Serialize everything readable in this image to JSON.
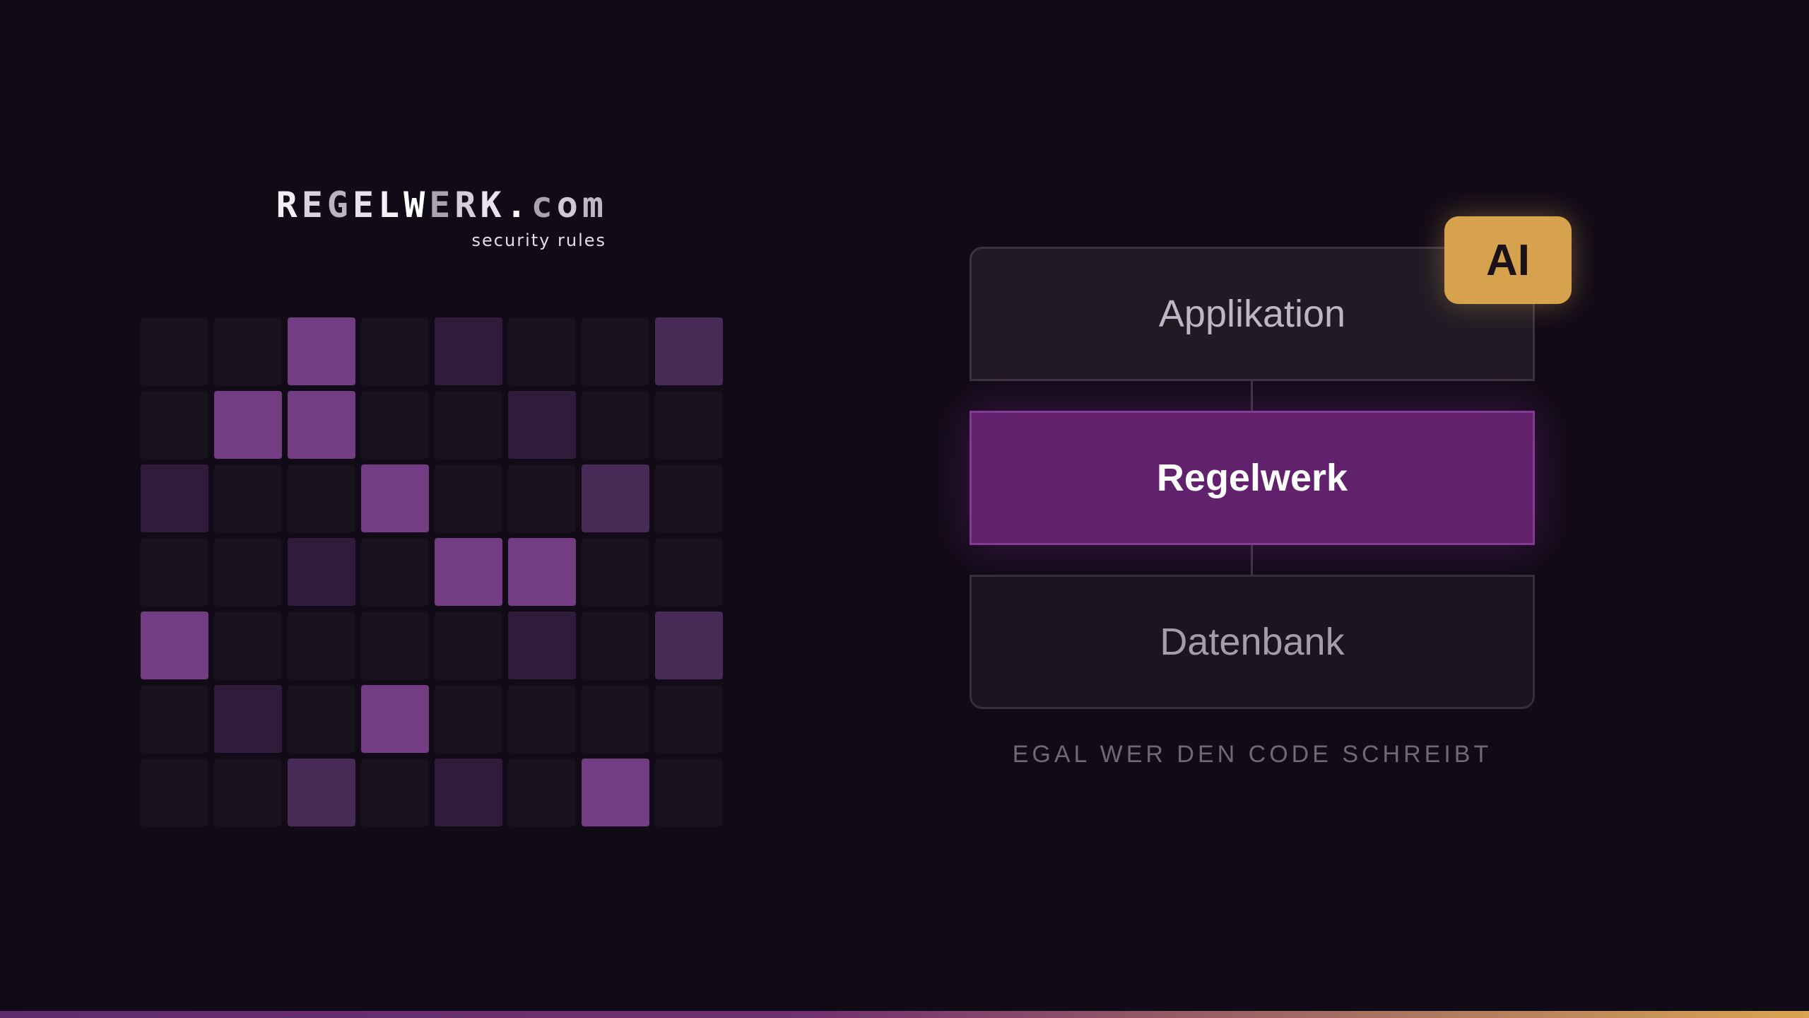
{
  "logo": {
    "letters": [
      {
        "char": "R",
        "color": "#f2eef4"
      },
      {
        "char": "E",
        "color": "#d8d3dc"
      },
      {
        "char": "G",
        "color": "#bab5c0"
      },
      {
        "char": "E",
        "color": "#e6e2ea"
      },
      {
        "char": "L",
        "color": "#f6f3f8"
      },
      {
        "char": "W",
        "color": "#ffffff"
      },
      {
        "char": "E",
        "color": "#a9a4af"
      },
      {
        "char": "R",
        "color": "#d4d0d8"
      },
      {
        "char": "K",
        "color": "#e8e4ec"
      },
      {
        "char": ".",
        "color": "#ffffff"
      },
      {
        "char": "c",
        "color": "#a8a3ad"
      },
      {
        "char": "o",
        "color": "#cfcbd4"
      },
      {
        "char": "m",
        "color": "#bdb8c3"
      }
    ],
    "tagline": "security rules"
  },
  "grid": {
    "rows": [
      [
        0,
        0,
        3,
        0,
        1,
        0,
        0,
        2
      ],
      [
        0,
        3,
        3,
        0,
        0,
        1,
        0,
        0
      ],
      [
        1,
        0,
        0,
        3,
        0,
        0,
        2,
        0
      ],
      [
        0,
        0,
        1,
        0,
        3,
        3,
        0,
        0
      ],
      [
        3,
        0,
        0,
        0,
        0,
        1,
        0,
        2
      ],
      [
        0,
        1,
        0,
        3,
        0,
        0,
        0,
        0
      ],
      [
        0,
        0,
        2,
        0,
        1,
        0,
        3,
        0
      ]
    ]
  },
  "stack": {
    "layers": [
      {
        "label": "Applikation"
      },
      {
        "label": "Regelwerk"
      },
      {
        "label": "Datenbank"
      }
    ],
    "badge": "AI",
    "caption": "EGAL WER DEN CODE SCHREIBT"
  },
  "colors": {
    "background": "#110b17",
    "accent_purple": "#62216c",
    "accent_gold": "#d7a24e"
  }
}
